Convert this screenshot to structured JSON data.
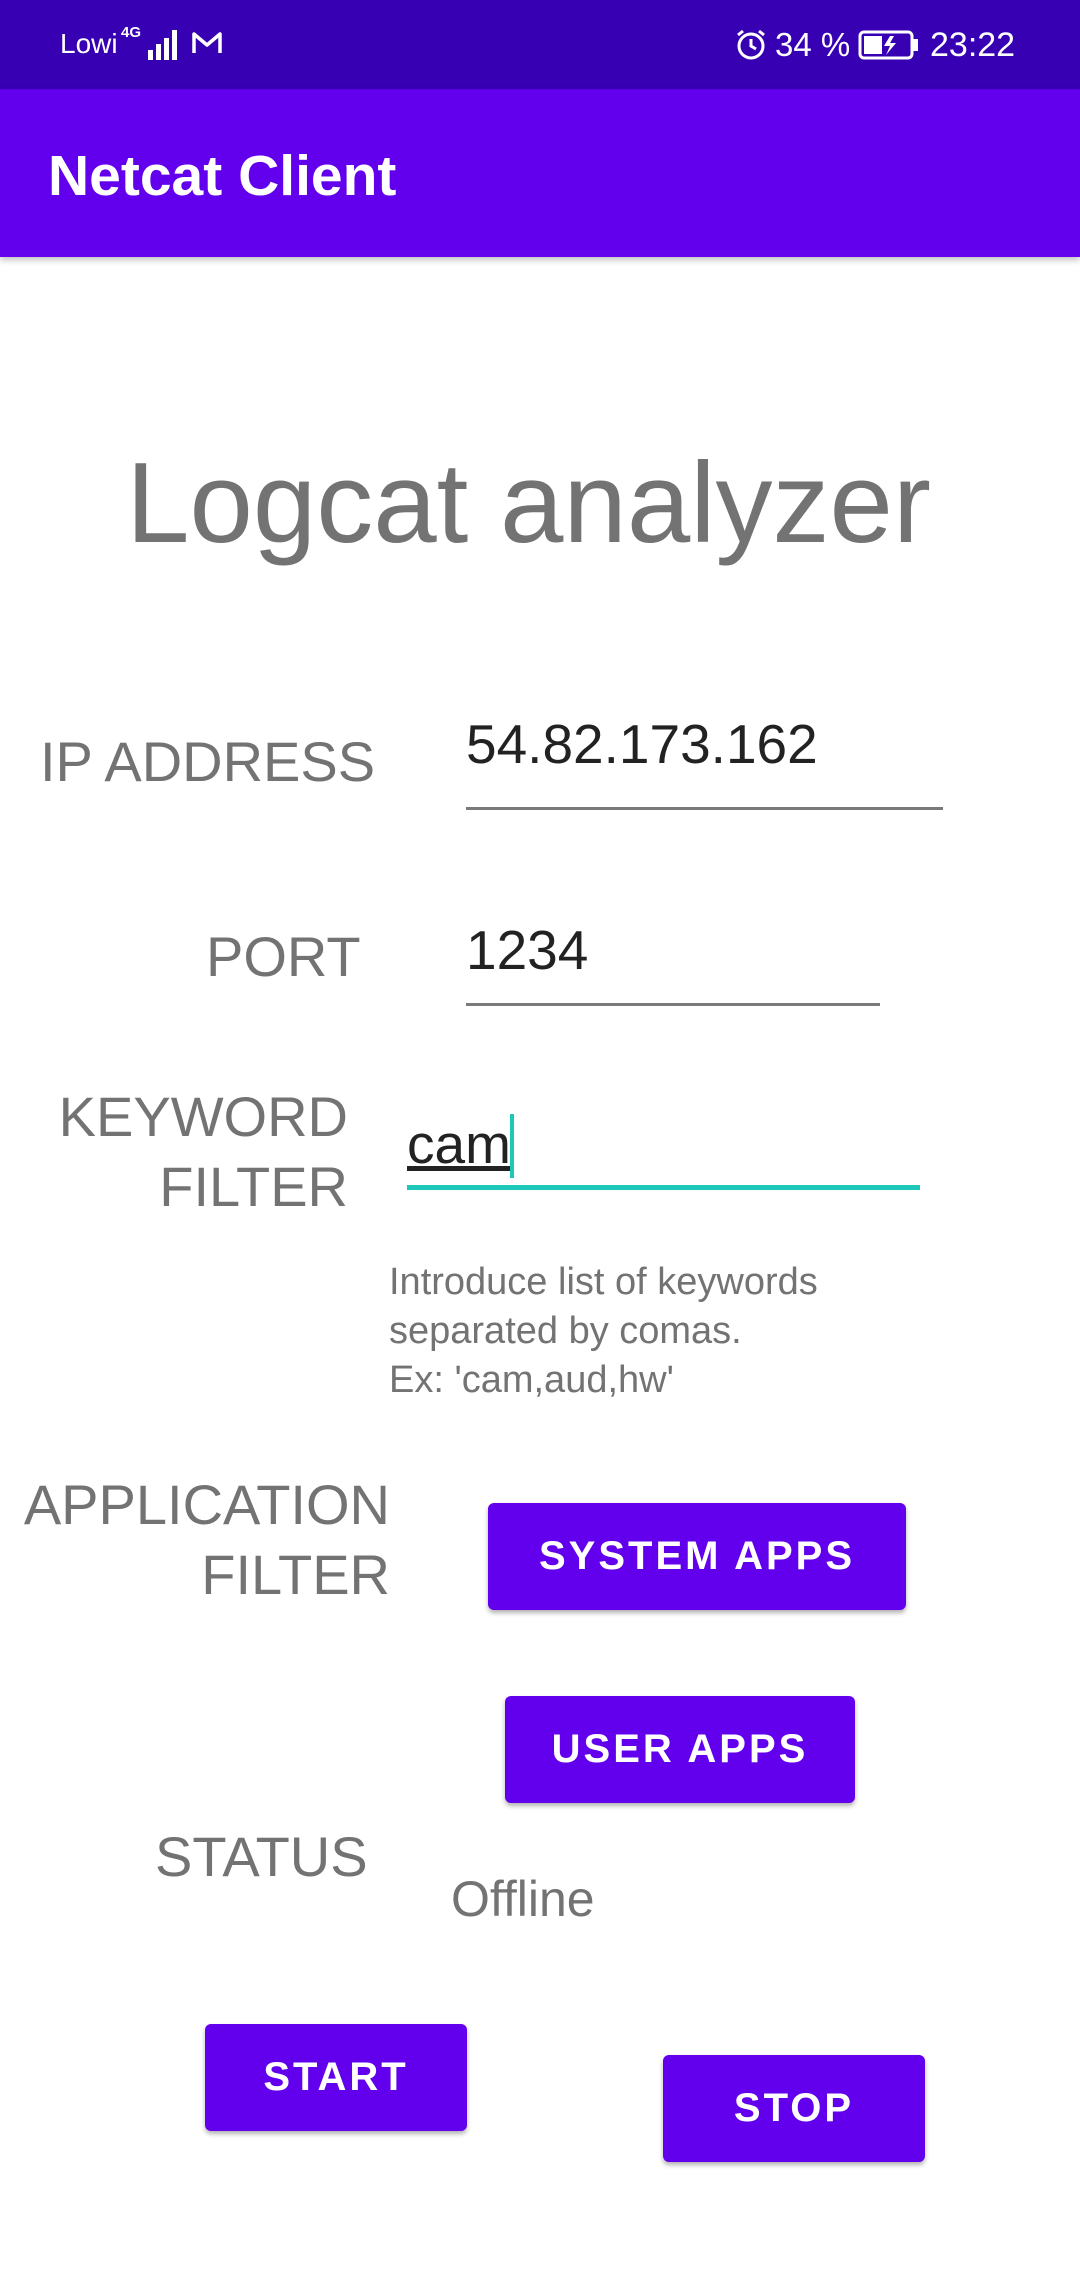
{
  "status_bar": {
    "carrier": "Lowi",
    "network_type": "4G",
    "battery_percent": "34 %",
    "time": "23:22",
    "icons": [
      "signal-icon",
      "mail-icon",
      "alarm-icon",
      "battery-charging-icon"
    ]
  },
  "app_bar": {
    "title": "Netcat Client"
  },
  "main": {
    "title": "Logcat analyzer",
    "ip": {
      "label": "IP ADDRESS",
      "value": "54.82.173.162"
    },
    "port": {
      "label": "PORT",
      "value": "1234"
    },
    "keyword": {
      "label": "KEYWORD\nFILTER",
      "value": "cam",
      "help": "Introduce list of keywords\nseparated by comas.\nEx: 'cam,aud,hw'"
    },
    "application_filter": {
      "label": "APPLICATION\nFILTER",
      "system_apps_button": "SYSTEM APPS",
      "user_apps_button": "USER APPS"
    },
    "status": {
      "label": "STATUS",
      "value": "Offline"
    },
    "start_button": "START",
    "stop_button": "STOP"
  },
  "colors": {
    "status_bar": "#3700b3",
    "primary": "#6200ee",
    "accent": "#1ec8b8",
    "label_gray": "#737373"
  }
}
